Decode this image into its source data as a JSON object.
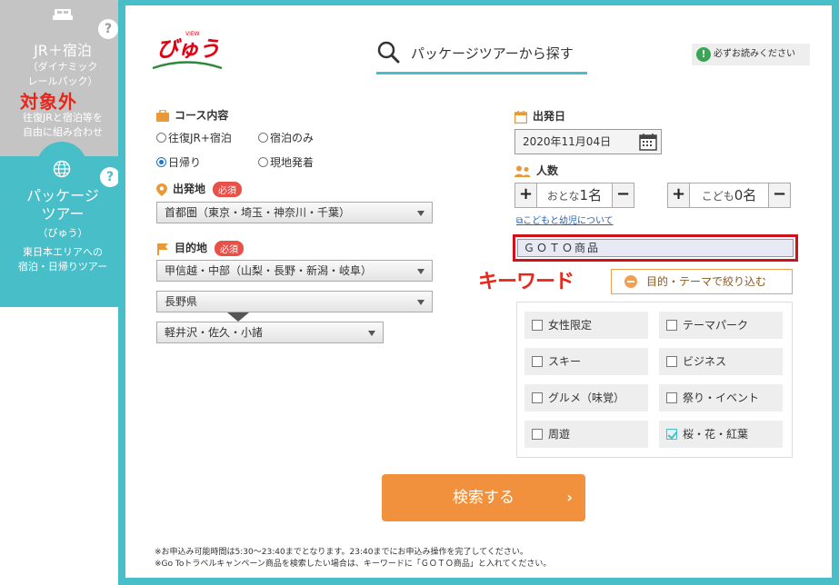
{
  "tabs": {
    "jr_stay": {
      "title": "JR＋宿泊",
      "sub1": "（ダイナミック",
      "sub2": "レールパック）",
      "desc1": "往復JRと宿泊等を",
      "desc2": "自由に組み合わせ",
      "help": "?",
      "overlay": "対象外"
    },
    "package": {
      "title1": "パッケージ",
      "title2": "ツアー",
      "sub": "（びゅう）",
      "desc1": "東日本エリアへの",
      "desc2": "宿泊・日帰りツアー",
      "help": "?"
    }
  },
  "header": {
    "logo": "びゅう",
    "logo_small": "VIEW",
    "search_title": "パッケージツアーから探す",
    "notice": "必ずお読みください",
    "notice_icon": "!"
  },
  "course": {
    "label": "コース内容",
    "options": [
      "往復JR+宿泊",
      "宿泊のみ",
      "日帰り",
      "現地発着"
    ],
    "selected": "日帰り"
  },
  "departure": {
    "label": "出発地",
    "required": "必須",
    "value": "首都圏（東京・埼玉・神奈川・千葉）"
  },
  "destination": {
    "label": "目的地",
    "required": "必須",
    "region": "甲信越・中部（山梨・長野・新潟・岐阜）",
    "prefecture": "長野県",
    "area": "軽井沢・佐久・小諸"
  },
  "date": {
    "label": "出発日",
    "value": "2020年11月04日"
  },
  "people": {
    "label": "人数",
    "adult_label": "おとな",
    "adult_count": "1名",
    "child_label": "こども",
    "child_count": "0名",
    "plus": "+",
    "minus": "−",
    "link": "こどもと幼児について"
  },
  "keyword": {
    "value": "ＧＯＴＯ商品",
    "annotation": "キーワード"
  },
  "themes": {
    "toggle": "目的・テーマで絞り込む",
    "items": [
      {
        "label": "女性限定",
        "checked": false
      },
      {
        "label": "テーマパーク",
        "checked": false
      },
      {
        "label": "スキー",
        "checked": false
      },
      {
        "label": "ビジネス",
        "checked": false
      },
      {
        "label": "グルメ（味覚）",
        "checked": false
      },
      {
        "label": "祭り・イベント",
        "checked": false
      },
      {
        "label": "周遊",
        "checked": false
      },
      {
        "label": "桜・花・紅葉",
        "checked": true
      }
    ]
  },
  "search": {
    "label": "検索する",
    "chevron": "›"
  },
  "notes": [
    "※お申込み可能時間は5:30〜23:40までとなります。23:40までにお申込み操作を完了してください。",
    "※Go Toトラベルキャンペーン商品を検索したい場合は、キーワードに「ＧＯＴＯ商品」と入れてください。"
  ],
  "colors": {
    "accent": "#47bec8",
    "orange": "#f2913d",
    "red": "#e8261a",
    "grey_tab": "#c4c4c4"
  }
}
